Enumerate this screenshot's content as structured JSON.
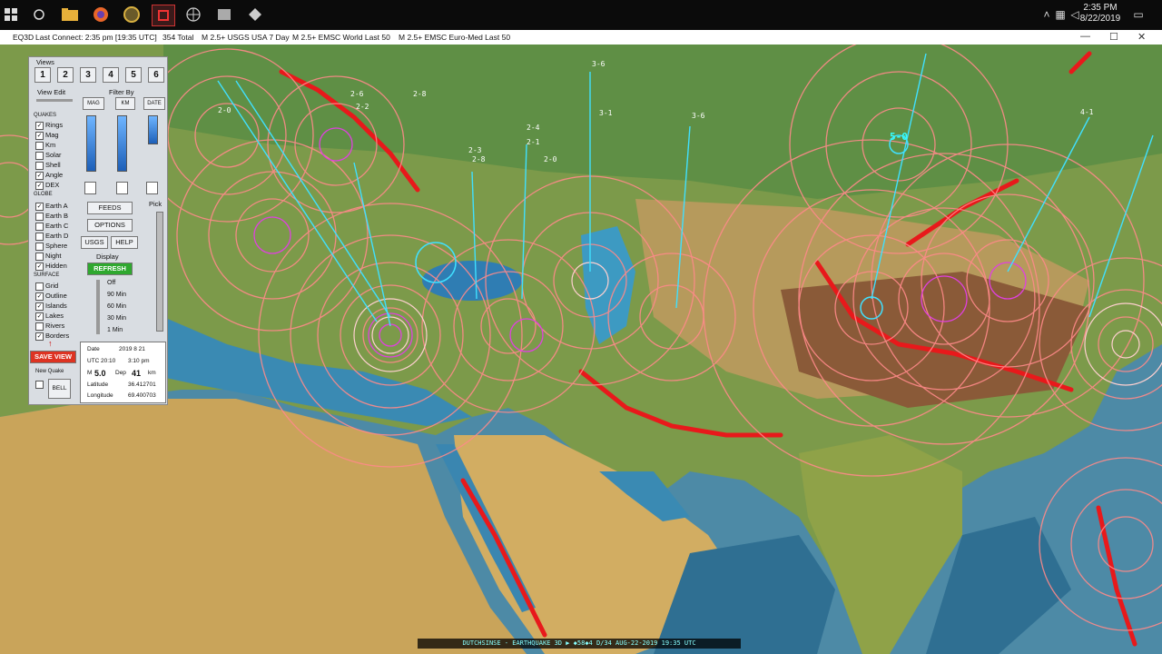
{
  "clock": {
    "time": "2:35 PM",
    "date": "8/22/2019"
  },
  "title": {
    "app": "EQ3D",
    "last_connect": "Last Connect: 2:35 pm  [19:35 UTC]",
    "total": "354  Total",
    "feed1": "M 2.5+  USGS USA 7 Day",
    "feed2": "M 2.5+  EMSC World Last 50",
    "feed3": "M 2.5+  EMSC Euro-Med Last 50"
  },
  "panel": {
    "views_label": "Views",
    "view_buttons": [
      "1",
      "2",
      "3",
      "4",
      "5",
      "6"
    ],
    "view_edit": "View Edit",
    "filter_by": "Filter By",
    "filter_headers": [
      "MAG",
      "KM",
      "DATE"
    ],
    "quakes_label": "QUAKES",
    "quake_options": [
      {
        "label": "Rings",
        "checked": "✓"
      },
      {
        "label": "Mag",
        "checked": "✓"
      },
      {
        "label": "Km",
        "checked": ""
      },
      {
        "label": "Solar",
        "checked": ""
      },
      {
        "label": "Shell",
        "checked": ""
      },
      {
        "label": "Angle",
        "checked": "✓"
      },
      {
        "label": "DEX",
        "checked": "✓"
      }
    ],
    "globe_label": "GLOBE",
    "globe_options": [
      {
        "label": "Earth A",
        "checked": "✓"
      },
      {
        "label": "Earth B",
        "checked": ""
      },
      {
        "label": "Earth C",
        "checked": ""
      },
      {
        "label": "Earth D",
        "checked": ""
      },
      {
        "label": "Sphere",
        "checked": ""
      },
      {
        "label": "Night",
        "checked": ""
      },
      {
        "label": "Hidden",
        "checked": "✓"
      }
    ],
    "surface_label": "SURFACE",
    "surface_options": [
      {
        "label": "Grid",
        "checked": ""
      },
      {
        "label": "Outline",
        "checked": "✓"
      },
      {
        "label": "Islands",
        "checked": "✓"
      },
      {
        "label": "Lakes",
        "checked": "✓"
      },
      {
        "label": "Rivers",
        "checked": ""
      },
      {
        "label": "Borders",
        "checked": "✓"
      }
    ],
    "feeds_btn": "FEEDS",
    "options_btn": "OPTIONS",
    "usgs_btn": "USGS",
    "help_btn": "HELP",
    "display_label": "Display",
    "refresh_btn": "REFRESH",
    "pick_label": "Pick",
    "refresh_options": [
      "Off",
      "90 Min",
      "60 Min",
      "30 Min",
      "1 Min"
    ],
    "save_view": "SAVE VIEW",
    "new_quake": "New Quake",
    "bell": "BELL",
    "info": {
      "date_label": "Date",
      "date": "2019  8  21",
      "utc_label": "UTC",
      "utc": "20:10",
      "local": "3:10 pm",
      "m_label": "M",
      "mag": "5.0",
      "dep_label": "Dep",
      "depth": "41",
      "depth_unit": "km",
      "lat_label": "Latitude",
      "lat": "36.412701",
      "lon_label": "Longitude",
      "lon": "69.400703"
    }
  },
  "map_labels": [
    "3-6",
    "3-1",
    "3-6",
    "2-8",
    "2-3",
    "2-8",
    "2-4",
    "2-1",
    "2-0",
    "5-0",
    "4-1",
    "2-0",
    "2-6",
    "2-2"
  ],
  "caption": "DUTCHSINSE - EARTHQUAKE 3D ▶ ◆58◆4 D/34 AUG-22-2019 19:35 UTC",
  "colors": {
    "ring": "#ff8a8a",
    "ring_light": "#ffd0d0",
    "magenta": "#e040e0",
    "cyan": "#40e0ff",
    "plate": "#e8191b"
  }
}
